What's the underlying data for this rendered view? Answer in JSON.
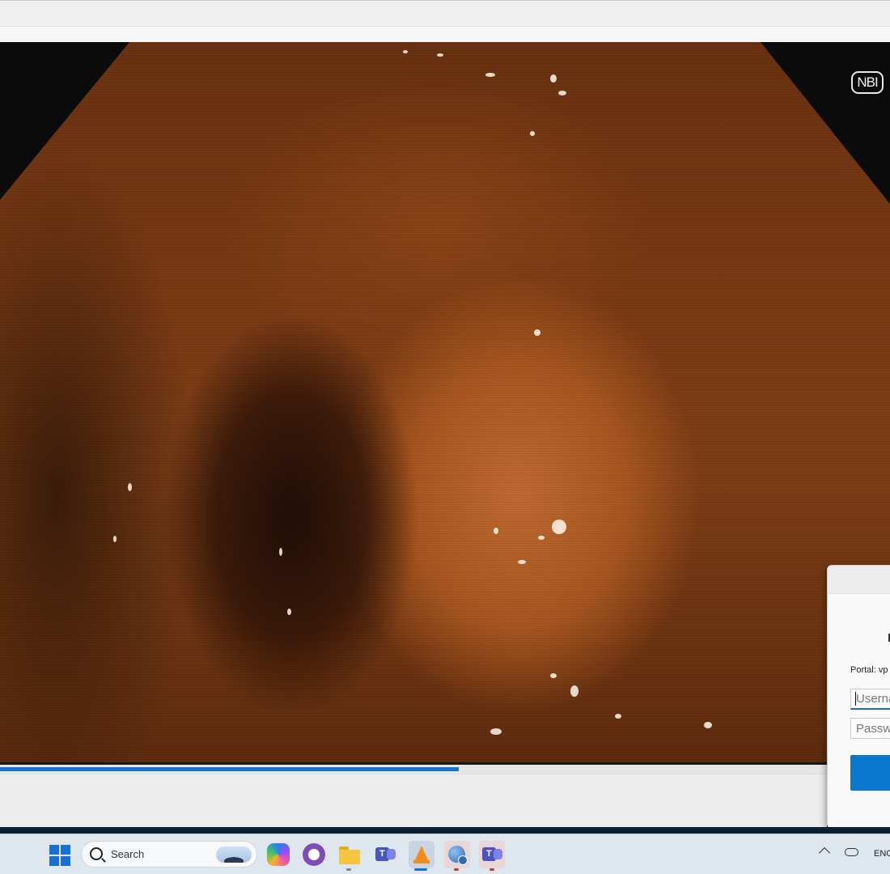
{
  "video": {
    "overlay_badge": "NBI",
    "progress": 0.555
  },
  "login_dialog": {
    "portal_label": "Portal: vp",
    "username_placeholder": "Userna",
    "password_placeholder": "Passwo"
  },
  "taskbar": {
    "search_placeholder": "Search",
    "apps": [
      "start-icon",
      "copilot-icon",
      "github-desktop-icon",
      "file-explorer-icon",
      "teams-icon",
      "vlc-icon",
      "vpn-globe-icon",
      "teams-work-icon"
    ],
    "tray": {
      "language": "ENG"
    }
  },
  "colors": {
    "progress_accent": "#1a73c8",
    "login_button": "#0a78cc",
    "taskbar_bg": "#dfe7ee"
  }
}
